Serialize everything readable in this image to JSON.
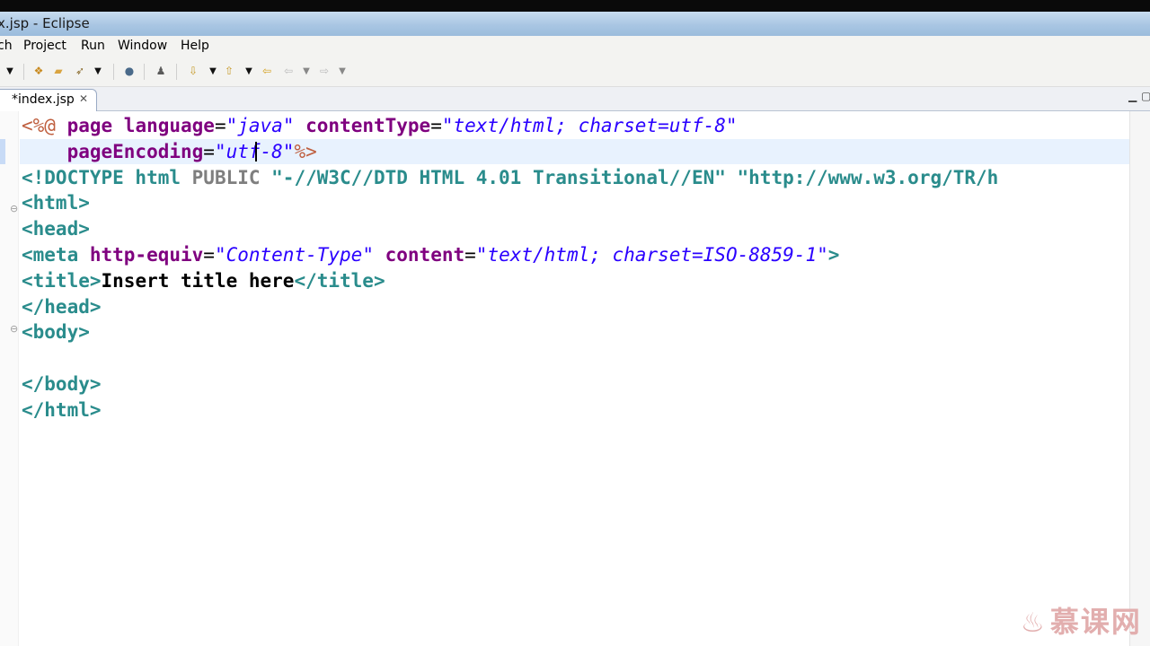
{
  "window": {
    "title": "x.jsp - Eclipse"
  },
  "menu": {
    "items": [
      "ch",
      "Project",
      "Run",
      "Window",
      "Help"
    ]
  },
  "toolbar": {
    "icons": [
      "dropdown-arrow",
      "open-icon",
      "folder-icon",
      "rocket-icon",
      "globe-icon",
      "person-icon",
      "next-annotation-icon",
      "previous-annotation-icon",
      "back-icon",
      "forward-icon"
    ]
  },
  "editor": {
    "tab": {
      "label": "*index.jsp",
      "close": "✕"
    },
    "lines": [
      {
        "segments": [
          {
            "t": "<%@ ",
            "c": "jsp"
          },
          {
            "t": "page ",
            "c": "attr"
          },
          {
            "t": "language",
            "c": "attr"
          },
          {
            "t": "=",
            "c": "eq"
          },
          {
            "t": "\"java\"",
            "c": "str"
          },
          {
            "t": " ",
            "c": "eq"
          },
          {
            "t": "contentType",
            "c": "attr"
          },
          {
            "t": "=",
            "c": "eq"
          },
          {
            "t": "\"text/html; charset=utf-8\"",
            "c": "str"
          }
        ]
      },
      {
        "segments": [
          {
            "t": "    ",
            "c": "eq"
          },
          {
            "t": "pageEncoding",
            "c": "attr"
          },
          {
            "t": "=",
            "c": "eq"
          },
          {
            "t": "\"utf-8\"",
            "c": "str"
          },
          {
            "t": "%>",
            "c": "jsp"
          }
        ]
      },
      {
        "segments": [
          {
            "t": "<!DOCTYPE html ",
            "c": "doctag"
          },
          {
            "t": "PUBLIC",
            "c": "kw"
          },
          {
            "t": " \"-//W3C//DTD HTML 4.01 Transitional//EN\" \"http://www.w3.org/TR/h",
            "c": "doctag"
          }
        ]
      },
      {
        "segments": [
          {
            "t": "<html>",
            "c": "boldtag"
          }
        ]
      },
      {
        "segments": [
          {
            "t": "<head>",
            "c": "boldtag"
          }
        ]
      },
      {
        "segments": [
          {
            "t": "<meta ",
            "c": "boldtag"
          },
          {
            "t": "http-equiv",
            "c": "attr"
          },
          {
            "t": "=",
            "c": "eq"
          },
          {
            "t": "\"Content-Type\"",
            "c": "str"
          },
          {
            "t": " ",
            "c": "eq"
          },
          {
            "t": "content",
            "c": "attr"
          },
          {
            "t": "=",
            "c": "eq"
          },
          {
            "t": "\"text/html; charset=ISO-8859-1\"",
            "c": "str"
          },
          {
            "t": ">",
            "c": "boldtag"
          }
        ]
      },
      {
        "segments": [
          {
            "t": "<title>",
            "c": "boldtag"
          },
          {
            "t": "Insert title here",
            "c": "txt"
          },
          {
            "t": "</title>",
            "c": "boldtag"
          }
        ]
      },
      {
        "segments": [
          {
            "t": "</head>",
            "c": "boldtag"
          }
        ]
      },
      {
        "segments": [
          {
            "t": "<body>",
            "c": "boldtag"
          }
        ]
      },
      {
        "segments": [
          {
            "t": "",
            "c": "eq"
          }
        ]
      },
      {
        "segments": [
          {
            "t": "</body>",
            "c": "boldtag"
          }
        ]
      },
      {
        "segments": [
          {
            "t": "</html>",
            "c": "boldtag"
          }
        ]
      }
    ]
  },
  "watermark": {
    "text": "慕课网"
  },
  "colors": {
    "tag": "#2a8c8c",
    "attribute": "#7f007f",
    "string": "#2a00ff",
    "jsp": "#bf5f3f",
    "current_line": "#e8f2fe"
  }
}
